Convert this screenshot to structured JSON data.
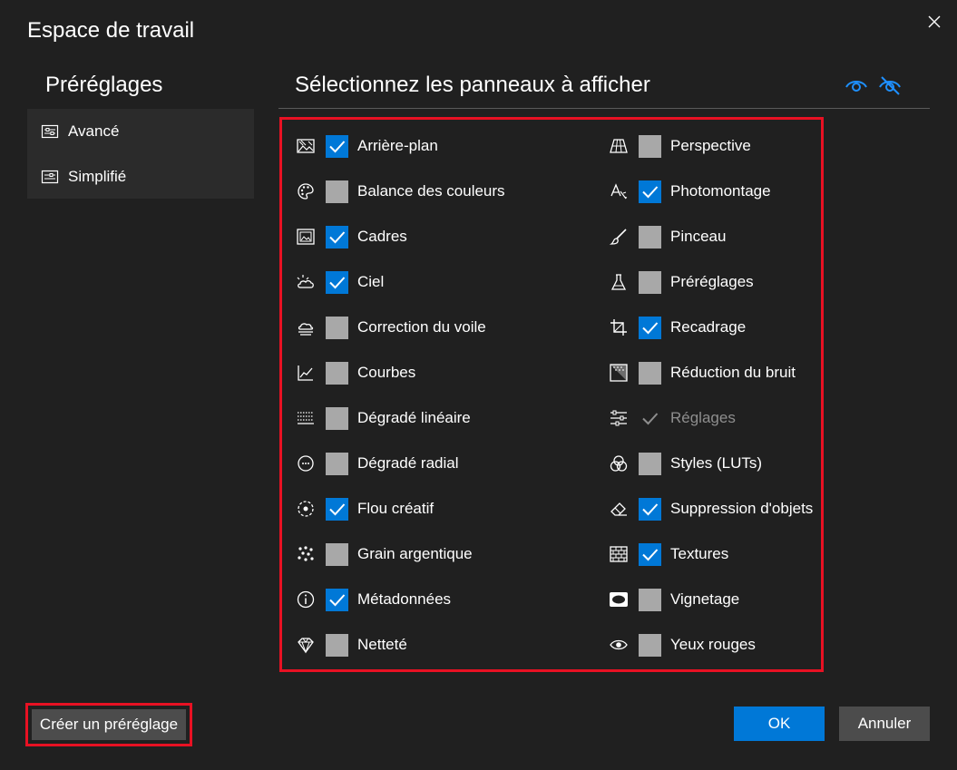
{
  "dialog": {
    "title": "Espace de travail"
  },
  "presets": {
    "heading": "Préréglages",
    "items": [
      {
        "label": "Avancé",
        "icon": "sliders-box-icon"
      },
      {
        "label": "Simplifié",
        "icon": "sliders-box-icon"
      }
    ]
  },
  "panels": {
    "heading": "Sélectionnez les panneaux à afficher",
    "show_all_icon": "eye-icon",
    "hide_all_icon": "eye-off-icon",
    "left": [
      {
        "label": "Arrière-plan",
        "checked": true,
        "icon": "background-icon"
      },
      {
        "label": "Balance des couleurs",
        "checked": false,
        "icon": "palette-icon"
      },
      {
        "label": "Cadres",
        "checked": true,
        "icon": "frame-icon"
      },
      {
        "label": "Ciel",
        "checked": true,
        "icon": "sky-icon"
      },
      {
        "label": "Correction du voile",
        "checked": false,
        "icon": "haze-icon"
      },
      {
        "label": "Courbes",
        "checked": false,
        "icon": "curves-icon"
      },
      {
        "label": "Dégradé linéaire",
        "checked": false,
        "icon": "linear-gradient-icon"
      },
      {
        "label": "Dégradé radial",
        "checked": false,
        "icon": "radial-gradient-icon"
      },
      {
        "label": "Flou créatif",
        "checked": true,
        "icon": "blur-icon"
      },
      {
        "label": "Grain argentique",
        "checked": false,
        "icon": "grain-icon"
      },
      {
        "label": "Métadonnées",
        "checked": true,
        "icon": "info-icon"
      },
      {
        "label": "Netteté",
        "checked": false,
        "icon": "diamond-icon"
      }
    ],
    "right": [
      {
        "label": "Perspective",
        "checked": false,
        "icon": "perspective-icon"
      },
      {
        "label": "Photomontage",
        "checked": true,
        "icon": "photomontage-icon"
      },
      {
        "label": "Pinceau",
        "checked": false,
        "icon": "brush-icon"
      },
      {
        "label": "Préréglages",
        "checked": false,
        "icon": "flask-icon"
      },
      {
        "label": "Recadrage",
        "checked": true,
        "icon": "crop-icon"
      },
      {
        "label": "Réduction du bruit",
        "checked": false,
        "icon": "noise-icon"
      },
      {
        "label": "Réglages",
        "checked": true,
        "disabled": true,
        "icon": "adjust-sliders-icon"
      },
      {
        "label": "Styles (LUTs)",
        "checked": false,
        "icon": "styles-icon"
      },
      {
        "label": "Suppression d'objets",
        "checked": true,
        "icon": "eraser-icon"
      },
      {
        "label": "Textures",
        "checked": true,
        "icon": "texture-icon"
      },
      {
        "label": "Vignetage",
        "checked": false,
        "icon": "vignette-icon"
      },
      {
        "label": "Yeux rouges",
        "checked": false,
        "icon": "eye-icon"
      }
    ]
  },
  "footer": {
    "create_label": "Créer un préréglage",
    "ok_label": "OK",
    "cancel_label": "Annuler"
  },
  "colors": {
    "background": "#202020",
    "accent": "#0078d7",
    "highlight": "#e81123",
    "unchecked": "#a8a8a8"
  }
}
